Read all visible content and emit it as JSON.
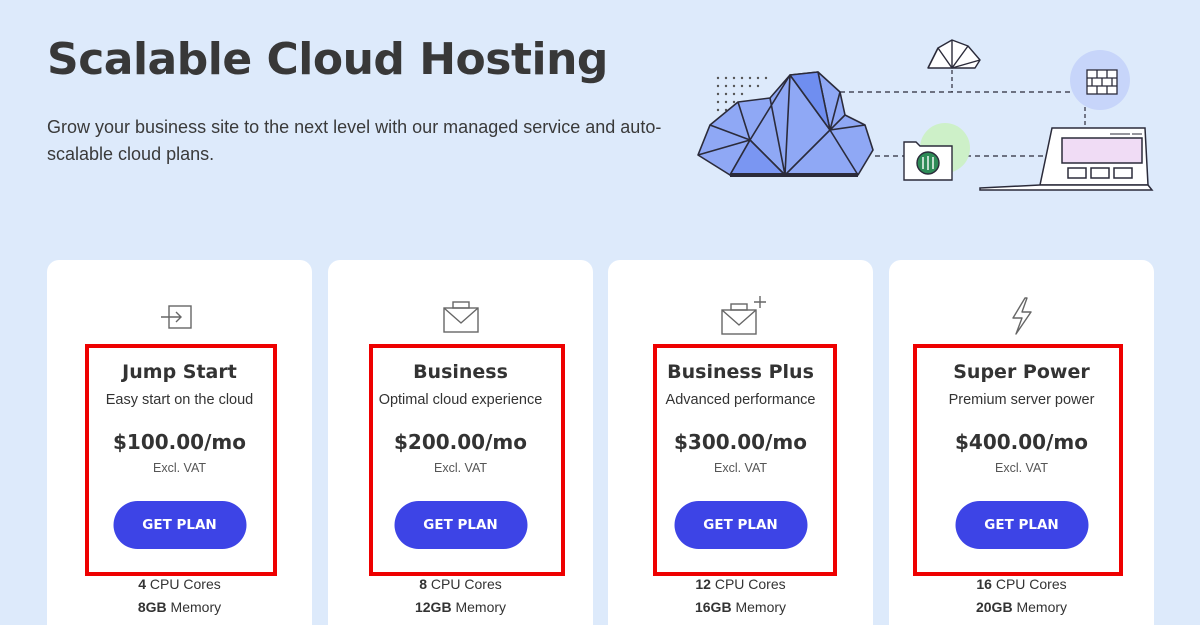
{
  "hero": {
    "title": "Scalable Cloud Hosting",
    "subtitle": "Grow your business site to the next level with our managed service and auto-scalable cloud plans."
  },
  "colors": {
    "background": "#ddeafb",
    "card": "#ffffff",
    "button": "#3d44e6",
    "highlight_border": "#ee0000",
    "cloud_fill": "#8fa8f5"
  },
  "plans": [
    {
      "icon": "arrow-into-box-icon",
      "name": "Jump Start",
      "tagline": "Easy start on the cloud",
      "price": "$100.00/mo",
      "vat": "Excl. VAT",
      "button": "GET PLAN",
      "cpu_value": "4",
      "cpu_label": " CPU Cores",
      "mem_value": "8GB",
      "mem_label": " Memory"
    },
    {
      "icon": "envelope-box-icon",
      "name": "Business",
      "tagline": "Optimal cloud experience",
      "price": "$200.00/mo",
      "vat": "Excl. VAT",
      "button": "GET PLAN",
      "cpu_value": "8",
      "cpu_label": " CPU Cores",
      "mem_value": "12GB",
      "mem_label": " Memory"
    },
    {
      "icon": "envelope-box-plus-icon",
      "name": "Business Plus",
      "tagline": "Advanced performance",
      "price": "$300.00/mo",
      "vat": "Excl. VAT",
      "button": "GET PLAN",
      "cpu_value": "12",
      "cpu_label": " CPU Cores",
      "mem_value": "16GB",
      "mem_label": " Memory"
    },
    {
      "icon": "lightning-bolt-icon",
      "name": "Super Power",
      "tagline": "Premium server power",
      "price": "$400.00/mo",
      "vat": "Excl. VAT",
      "button": "GET PLAN",
      "cpu_value": "16",
      "cpu_label": " CPU Cores",
      "mem_value": "20GB",
      "mem_label": " Memory"
    }
  ]
}
